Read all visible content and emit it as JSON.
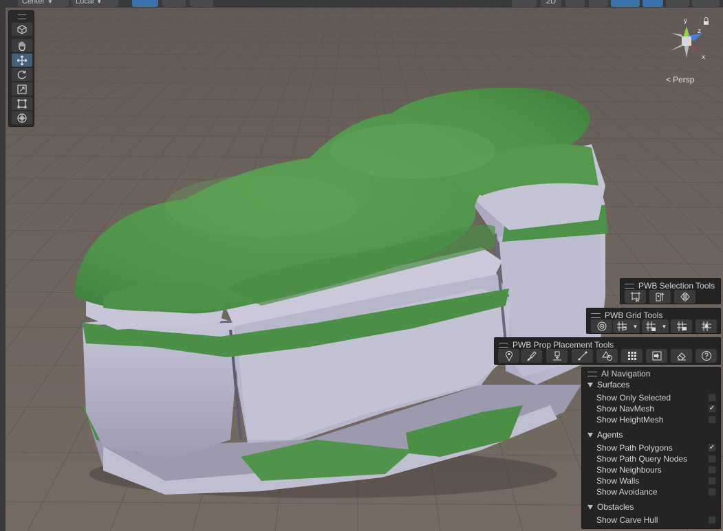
{
  "toolbar": {
    "pivot_mode": "Center",
    "pivot_rotation": "Local",
    "view_2d": "2D"
  },
  "scene_view": {
    "projection": "Persp",
    "gizmo_axes": {
      "x": "x",
      "y": "y",
      "z": "z"
    }
  },
  "tools": [
    {
      "name": "view-tool",
      "icon": "cube-icon"
    },
    {
      "name": "hand-tool",
      "icon": "hand-icon"
    },
    {
      "name": "move-tool",
      "icon": "move-icon",
      "active": true
    },
    {
      "name": "rotate-tool",
      "icon": "rotate-icon"
    },
    {
      "name": "scale-tool",
      "icon": "scale-icon"
    },
    {
      "name": "rect-tool",
      "icon": "rect-icon"
    },
    {
      "name": "transform-tool",
      "icon": "transform-icon"
    }
  ],
  "panels": {
    "selection_tools": {
      "title": "PWB Selection Tools"
    },
    "grid_tools": {
      "title": "PWB Grid Tools"
    },
    "prop_placement_tools": {
      "title": "PWB Prop Placement Tools"
    }
  },
  "ai_navigation": {
    "title": "AI Navigation",
    "sections": [
      {
        "name": "Surfaces",
        "items": [
          {
            "label": "Show Only Selected",
            "checked": false
          },
          {
            "label": "Show NavMesh",
            "checked": true
          },
          {
            "label": "Show HeightMesh",
            "checked": false
          }
        ]
      },
      {
        "name": "Agents",
        "items": [
          {
            "label": "Show Path Polygons",
            "checked": true
          },
          {
            "label": "Show Path Query Nodes",
            "checked": false
          },
          {
            "label": "Show Neighbours",
            "checked": false
          },
          {
            "label": "Show Walls",
            "checked": false
          },
          {
            "label": "Show Avoidance",
            "checked": false
          }
        ]
      },
      {
        "name": "Obstacles",
        "items": [
          {
            "label": "Show Carve Hull",
            "checked": false
          }
        ]
      }
    ]
  },
  "colors": {
    "ground": "#6f6560",
    "grass": "#5a9e52",
    "rock": "#b4b2c7",
    "panel": "#242424",
    "accent": "#3a72b0"
  }
}
